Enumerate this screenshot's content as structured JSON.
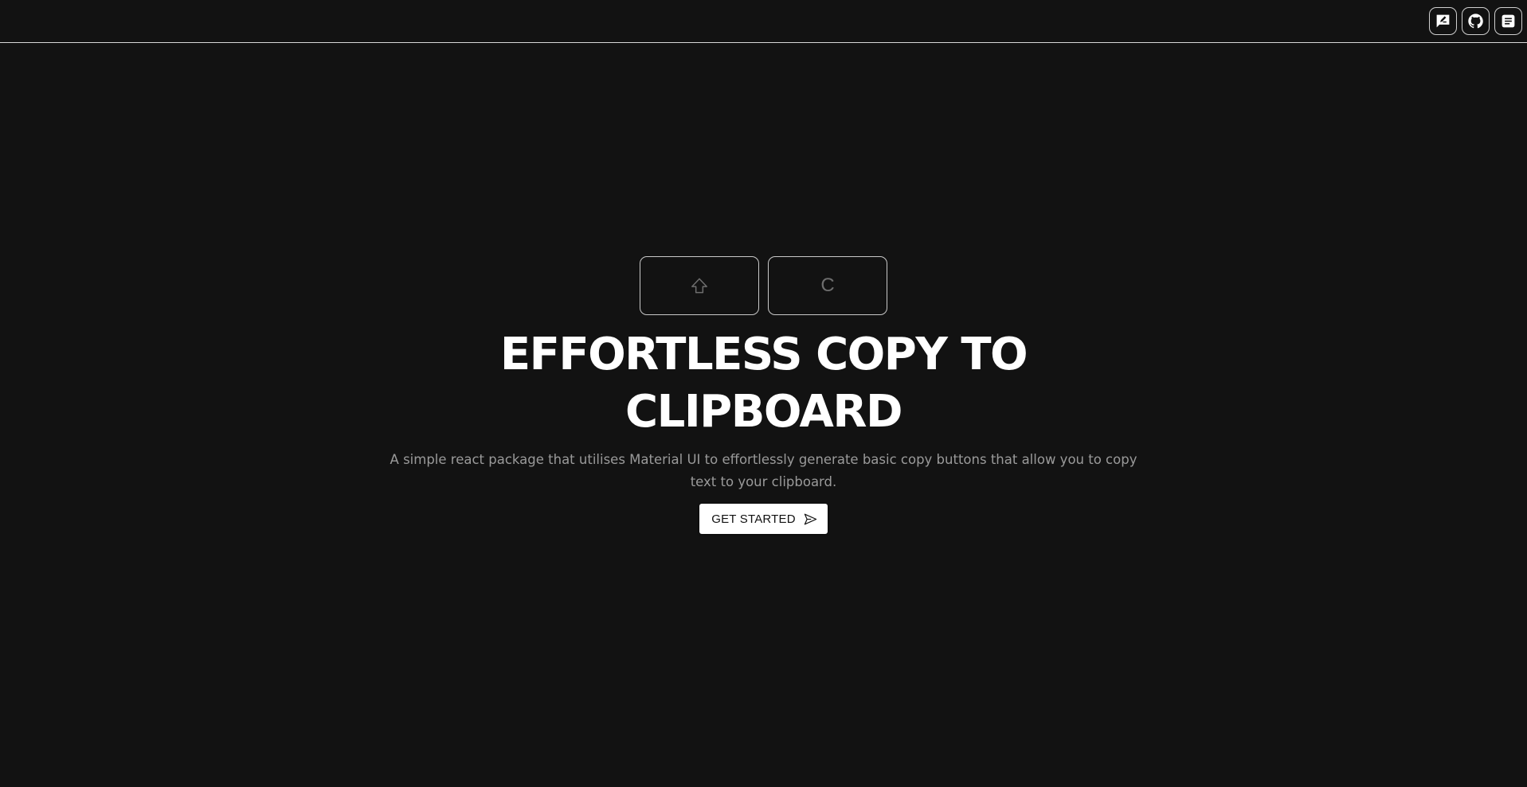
{
  "header": {
    "actions": [
      {
        "icon": "feedback-icon",
        "name": "feedback-button"
      },
      {
        "icon": "github-icon",
        "name": "github-button"
      },
      {
        "icon": "docs-icon",
        "name": "docs-button"
      }
    ]
  },
  "hero": {
    "keys": [
      {
        "icon": "shift-arrow-icon",
        "label": ""
      },
      {
        "label": "C"
      }
    ],
    "title": "EFFORTLESS COPY TO CLIPBOARD",
    "subtitle": "A simple react package that utilises Material UI to effortlessly generate basic copy buttons that allow you to copy text to your clipboard.",
    "cta": {
      "label": "GET STARTED",
      "icon": "send-icon"
    }
  },
  "colors": {
    "background": "#121212",
    "text": "#ffffff",
    "muted_text": "#9a9a9a",
    "border": "#d8d8d8",
    "button_bg": "#ffffff"
  }
}
